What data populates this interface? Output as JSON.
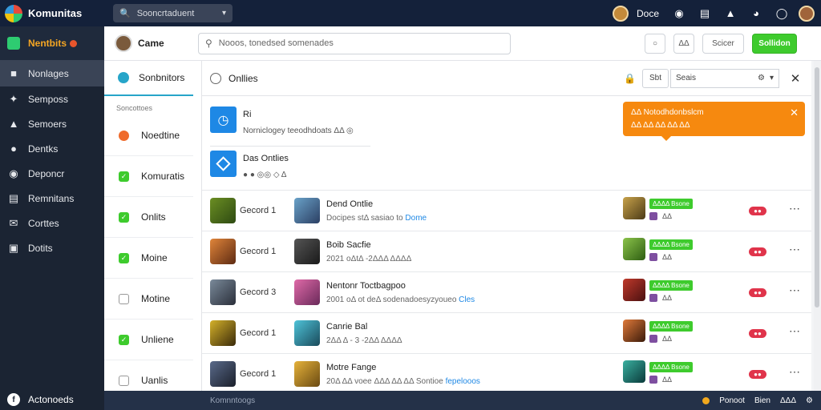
{
  "app": {
    "name": "Komunitas",
    "top_search": "Sooncrtaduent",
    "user": "Doce"
  },
  "sidebar": {
    "brand_label": "Nentbits",
    "items": [
      {
        "label": "Nonlages",
        "icon": "home-icon"
      },
      {
        "label": "Semposs",
        "icon": "wrench-icon"
      },
      {
        "label": "Semoers",
        "icon": "user-icon"
      },
      {
        "label": "Dentks",
        "icon": "person-icon"
      },
      {
        "label": "Deponcr",
        "icon": "compass-icon"
      },
      {
        "label": "Remnitans",
        "icon": "list-icon"
      },
      {
        "label": "Corttes",
        "icon": "mail-icon"
      },
      {
        "label": "Dotits",
        "icon": "box-icon"
      }
    ],
    "footer": "Actonoeds"
  },
  "header": {
    "title": "Came",
    "search_placeholder": "Nooos, tonedsed somenades",
    "btn_a": "○",
    "btn_b": "ΔΔ",
    "btn_c": "Scicer",
    "btn_primary": "Sollidon"
  },
  "filters": {
    "title": "Sonbnitors",
    "subtitle": "Soncottoes",
    "items": [
      {
        "label": "Noedtine",
        "state": "orange"
      },
      {
        "label": "Komuratis",
        "state": "green"
      },
      {
        "label": "Onlits",
        "state": "green"
      },
      {
        "label": "Moine",
        "state": "green"
      },
      {
        "label": "Motine",
        "state": "none"
      },
      {
        "label": "Unliene",
        "state": "green"
      },
      {
        "label": "Uanlis",
        "state": "none"
      }
    ]
  },
  "main": {
    "title": "Onllies",
    "lock_btn": "Sbt",
    "select_label": "Seais",
    "card1": {
      "l1": "Ri",
      "l2": "Norniclogey teeodhdoats ΔΔ ◎"
    },
    "card2": {
      "l1": "Das Ontlies",
      "l2": "●  ●  ◎◎  ◇  Δ"
    },
    "toast": {
      "l1": "ΔΔ  Notodhdonbslcm",
      "l2": "ΔΔ  ΔΔ ΔΔ ΔΔ ΔΔ"
    }
  },
  "rows": [
    {
      "rank": "Gecord 1",
      "name": "Dend Ontlie",
      "meta": "Docipes stΔ sasiao to",
      "link": "Dome",
      "tag": "ΔΔΔΔ Bsone",
      "sub": "ΔΔ"
    },
    {
      "rank": "Gecord 1",
      "name": "Boib Sacfie",
      "meta": "2021 oΔtΔ -2ΔΔΔ ΔΔΔΔ",
      "link": "",
      "tag": "ΔΔΔΔ Bsone",
      "sub": "ΔΔ"
    },
    {
      "rank": "Gecord 3",
      "name": "Nentonr Toctbagpoo",
      "meta": "2001 oΔ ot deΔ sodenadoesyzyoueo",
      "link": "Cles",
      "tag": "ΔΔΔΔ Bsone",
      "sub": "ΔΔ"
    },
    {
      "rank": "Gecord 1",
      "name": "Canrie Bal",
      "meta": "2ΔΔ Δ - 3 -2ΔΔ ΔΔΔΔ",
      "link": "",
      "tag": "ΔΔΔΔ Bsone",
      "sub": "ΔΔ"
    },
    {
      "rank": "Gecord 1",
      "name": "Motre Fange",
      "meta": "20Δ ΔΔ voee ΔΔΔ ΔΔ ΔΔ Sontioe",
      "link": "fepelooos",
      "tag": "ΔΔΔΔ Bsone",
      "sub": "ΔΔ"
    }
  ],
  "status": {
    "ghost": "Komnntoogs",
    "a": "Ponoot",
    "b": "Bien",
    "c": "ΔΔΔ"
  },
  "colors": {
    "accent": "#3ecb2d",
    "toast": "#f6890f",
    "sidebar": "#1b2433",
    "topbar": "#14213a",
    "pill": "#e0344b"
  }
}
